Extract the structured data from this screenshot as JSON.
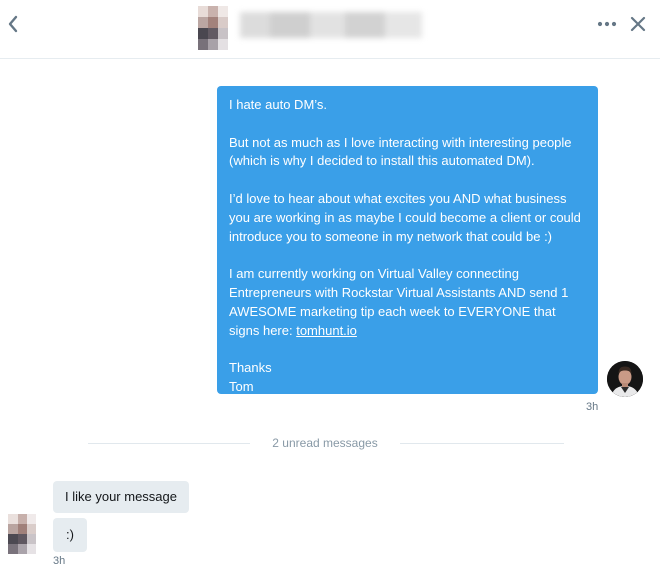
{
  "header": {
    "back_icon": "chevron-left-icon",
    "more_icon": "more-horizontal-icon",
    "close_icon": "close-icon",
    "accent_color": "#657786"
  },
  "conversation": {
    "sent_message": {
      "paragraphs": [
        "I hate auto DM’s.",
        "But not as much as I love interacting with interesting people (which is why I decided to install this automated DM).",
        "I’d love to hear about what excites you AND what business you are working in as maybe I could become a client or could introduce you to someone in my network that could be :)",
        "I am currently working on Virtual Valley connecting Entrepreneurs with Rockstar Virtual Assistants AND send 1 AWESOME marketing tip each week to EVERYONE that signs here: "
      ],
      "link_text": "tomhunt.io",
      "closing_1": "Thanks",
      "closing_2": "Tom",
      "time": "3h",
      "bubble_color": "#3a9fe8"
    },
    "unread_divider": "2 unread messages",
    "received_messages": [
      {
        "text": "I like your message"
      },
      {
        "text": ":)"
      }
    ],
    "received_time": "3h",
    "received_bubble_color": "#e6ecf0"
  }
}
